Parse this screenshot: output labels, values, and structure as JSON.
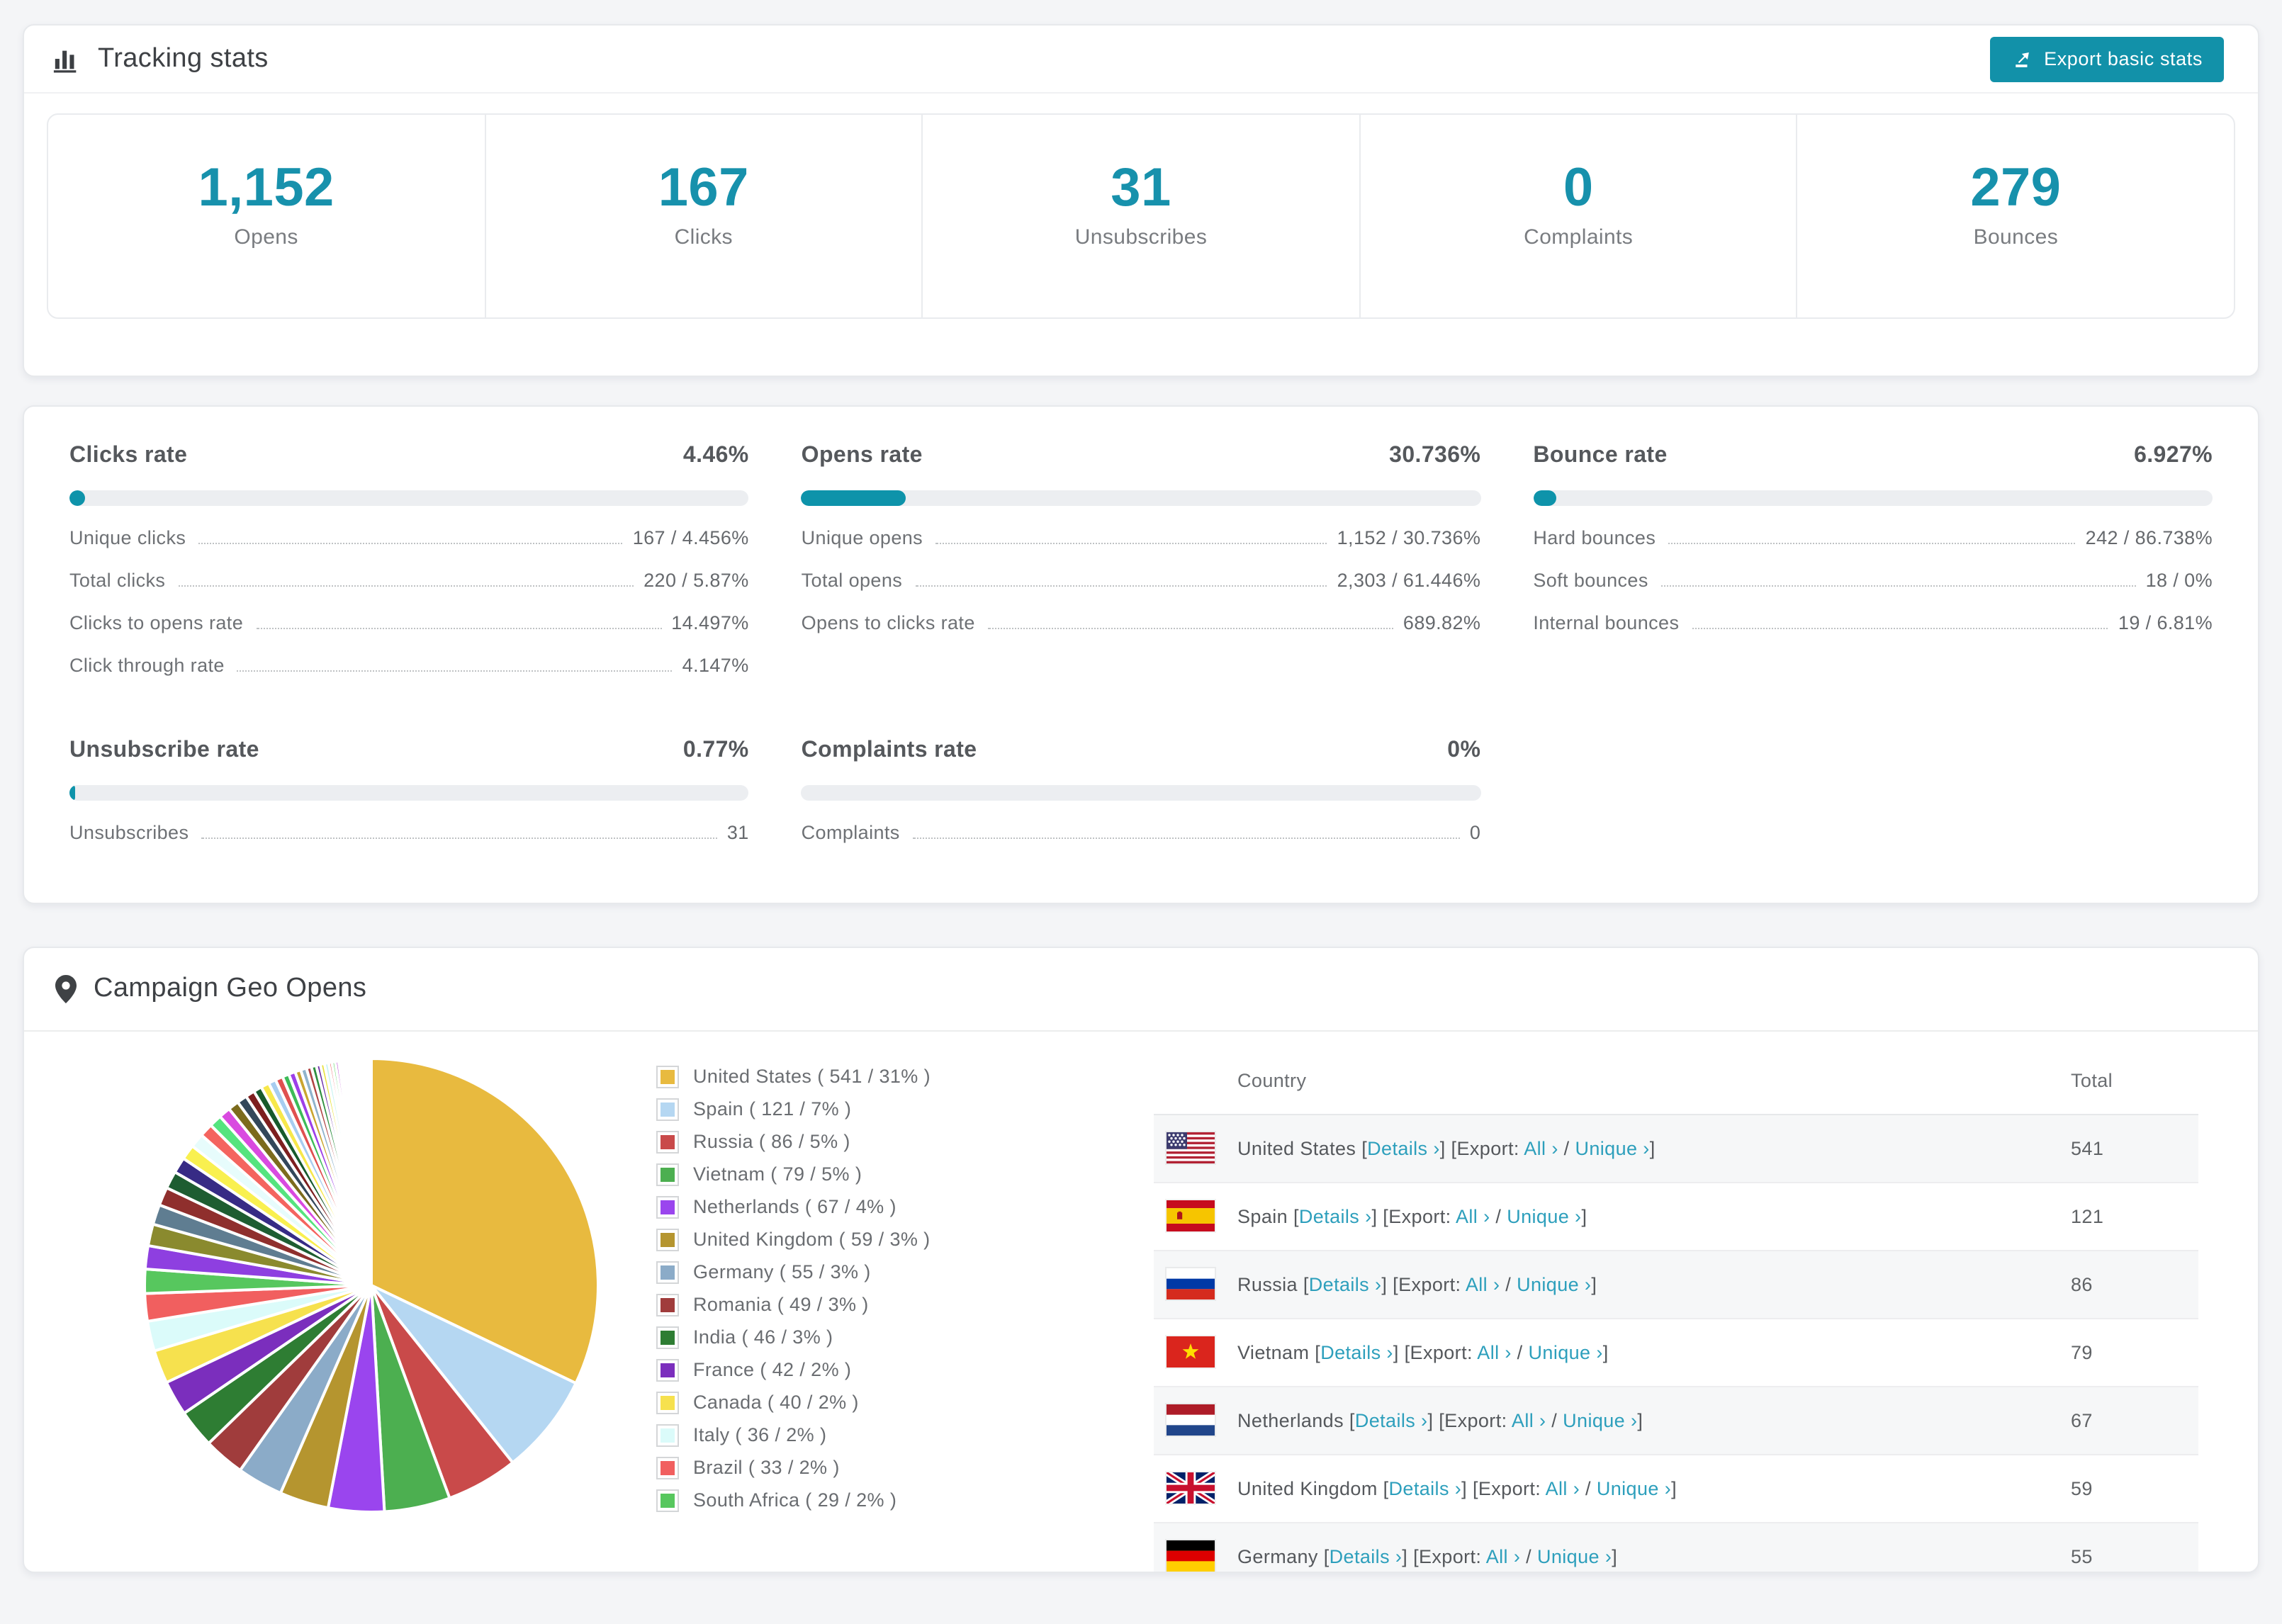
{
  "tracking": {
    "title": "Tracking stats",
    "export_button": "Export basic stats",
    "summary": [
      {
        "value": "1,152",
        "label": "Opens"
      },
      {
        "value": "167",
        "label": "Clicks"
      },
      {
        "value": "31",
        "label": "Unsubscribes"
      },
      {
        "value": "0",
        "label": "Complaints"
      },
      {
        "value": "279",
        "label": "Bounces"
      }
    ]
  },
  "rates": {
    "accent_color": "#0e93aa",
    "clicks": {
      "title": "Clicks rate",
      "value": "4.46%",
      "percent": 4.46,
      "rows": [
        {
          "label": "Unique clicks",
          "value": "167 / 4.456%"
        },
        {
          "label": "Total clicks",
          "value": "220 / 5.87%"
        },
        {
          "label": "Clicks to opens rate",
          "value": "14.497%"
        },
        {
          "label": "Click through rate",
          "value": "4.147%"
        }
      ]
    },
    "opens": {
      "title": "Opens rate",
      "value": "30.736%",
      "percent": 30.736,
      "rows": [
        {
          "label": "Unique opens",
          "value": "1,152 / 30.736%"
        },
        {
          "label": "Total opens",
          "value": "2,303 / 61.446%"
        },
        {
          "label": "Opens to clicks rate",
          "value": "689.82%"
        }
      ]
    },
    "bounce": {
      "title": "Bounce rate",
      "value": "6.927%",
      "percent": 6.927,
      "rows": [
        {
          "label": "Hard bounces",
          "value": "242 / 86.738%"
        },
        {
          "label": "Soft bounces",
          "value": "18 / 0%"
        },
        {
          "label": "Internal bounces",
          "value": "19 / 6.81%"
        }
      ]
    },
    "unsubscribe": {
      "title": "Unsubscribe rate",
      "value": "0.77%",
      "percent": 0.77,
      "rows": [
        {
          "label": "Unsubscribes",
          "value": "31"
        }
      ]
    },
    "complaints": {
      "title": "Complaints rate",
      "value": "0%",
      "percent": 0,
      "rows": [
        {
          "label": "Complaints",
          "value": "0"
        }
      ]
    }
  },
  "geo": {
    "title": "Campaign Geo Opens",
    "table": {
      "columns": {
        "country": "Country",
        "total": "Total"
      },
      "link_details": "Details",
      "label_export": "Export:",
      "link_all": "All",
      "link_unique": "Unique",
      "arrow": "›",
      "rows": [
        {
          "country": "United States",
          "flag": "us",
          "total": "541"
        },
        {
          "country": "Spain",
          "flag": "es",
          "total": "121"
        },
        {
          "country": "Russia",
          "flag": "ru",
          "total": "86"
        },
        {
          "country": "Vietnam",
          "flag": "vn",
          "total": "79"
        },
        {
          "country": "Netherlands",
          "flag": "nl",
          "total": "67"
        },
        {
          "country": "United Kingdom",
          "flag": "gb",
          "total": "59"
        },
        {
          "country": "Germany",
          "flag": "de",
          "total": "55"
        }
      ]
    }
  },
  "chart_data": {
    "type": "pie",
    "title": "Campaign Geo Opens",
    "legend_position": "right",
    "start_angle": 0,
    "direction": "clockwise",
    "series": [
      {
        "name": "United States",
        "value": 541,
        "pct": "31%",
        "color": "#e8ba3f"
      },
      {
        "name": "Spain",
        "value": 121,
        "pct": "7%",
        "color": "#b5d7f2"
      },
      {
        "name": "Russia",
        "value": 86,
        "pct": "5%",
        "color": "#c94a4a"
      },
      {
        "name": "Vietnam",
        "value": 79,
        "pct": "5%",
        "color": "#4caf50"
      },
      {
        "name": "Netherlands",
        "value": 67,
        "pct": "4%",
        "color": "#9a45ee"
      },
      {
        "name": "United Kingdom",
        "value": 59,
        "pct": "3%",
        "color": "#b5952f"
      },
      {
        "name": "Germany",
        "value": 55,
        "pct": "3%",
        "color": "#8babc8"
      },
      {
        "name": "Romania",
        "value": 49,
        "pct": "3%",
        "color": "#a03c3c"
      },
      {
        "name": "India",
        "value": 46,
        "pct": "3%",
        "color": "#2e7d33"
      },
      {
        "name": "France",
        "value": 42,
        "pct": "2%",
        "color": "#7b2ebd"
      },
      {
        "name": "Canada",
        "value": 40,
        "pct": "2%",
        "color": "#f6e14e"
      },
      {
        "name": "Italy",
        "value": 36,
        "pct": "2%",
        "color": "#dbfbfa"
      },
      {
        "name": "Brazil",
        "value": 33,
        "pct": "2%",
        "color": "#f15f5f"
      },
      {
        "name": "South Africa",
        "value": 29,
        "pct": "2%",
        "color": "#57c75e"
      }
    ],
    "others": {
      "values": [
        28,
        26,
        24,
        22,
        21,
        19,
        18,
        17,
        16,
        15,
        14,
        13,
        12,
        11,
        10,
        10,
        9,
        9,
        8,
        8,
        7,
        7,
        6,
        6,
        5,
        5,
        5,
        4,
        4,
        4,
        3,
        3,
        3,
        3,
        2,
        2,
        2,
        2,
        2,
        2,
        1,
        1,
        1,
        1,
        1,
        1,
        1,
        1,
        1,
        1,
        1,
        1,
        1,
        1,
        1
      ],
      "palette": [
        "#8e3fe0",
        "#8a8a2e",
        "#5f7d91",
        "#8f2f2d",
        "#1e5d31",
        "#372b85",
        "#f9f04f",
        "#e7fcfc",
        "#f4645f",
        "#55e47e",
        "#d94ae0",
        "#7c6b1d",
        "#33475a",
        "#7d1f1f",
        "#175a2c",
        "#f7e84b",
        "#a7cdf0",
        "#e05050",
        "#3dbb58",
        "#9d3fe8",
        "#caa52f",
        "#8fb3cc",
        "#b04444",
        "#2f8f3f",
        "#6a2ea8",
        "#e8e23f",
        "#c8f4f2",
        "#ef7070",
        "#66d96a",
        "#c050d8",
        "#908428",
        "#4a6377",
        "#942f2f",
        "#215f33",
        "#4336a0"
      ]
    }
  }
}
